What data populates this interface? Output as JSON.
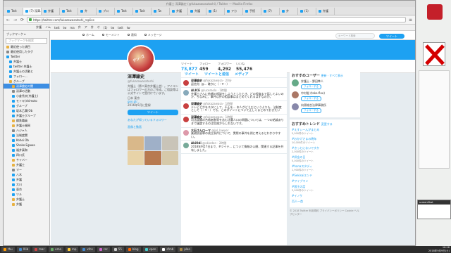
{
  "window": {
    "title": "弁護士 深澤論史 (@fukazawasatoshi) / Twitter — Mozilla Firefox"
  },
  "tabs": [
    "Twit",
    "(7) 深澤...",
    "弁護",
    "Twit",
    "弁",
    "プロ",
    "Twit",
    "Twit",
    "Tw",
    "弁護",
    "弁護",
    "(1)",
    "アカ",
    "手続",
    "(7)",
    "弁",
    "(1)",
    "弁護"
  ],
  "url": "https://twitter.com/fukazawasatoshi_replies",
  "bookmarks": [
    "弁護",
    "ノム",
    "twit",
    "tw",
    "ma",
    "弁",
    "ア",
    "弁",
    "オ",
    "(1)",
    "tw",
    "twit",
    "tw"
  ],
  "sidebar": {
    "header": "ブックマーク ▾",
    "search_placeholder": "ブックマークを検索",
    "items": [
      "最近使った項目",
      "最近使用したタグ",
      "Twitter",
      "弁護士",
      "twitter 弁護士",
      "弁護士の活動と",
      "フォロー...",
      "グループ",
      "深澤論史の関",
      "深澤の活動",
      "小倉秀夫(弁護士)",
      "モトキ(shimoto",
      "グループ",
      "坂本乙葉(Ob",
      "弁護士グループ",
      "鋼鉄職員",
      "弁護士福岡",
      "ハジャ人",
      "法制度関",
      "Kohei Ob",
      "Shoko Egawa",
      "福井真和",
      "四川氏",
      "サイバー",
      "弁護士",
      "マー",
      "八木",
      "弁護",
      "大川",
      "東京",
      "ツル",
      "弁護士",
      "弁護"
    ]
  },
  "twitter_nav": {
    "home": "ホーム",
    "moments": "モーメント",
    "notifications": "通知",
    "messages": "メッセージ",
    "search_placeholder": "キーワード検索",
    "tweet_button": "ツイート"
  },
  "stats": [
    {
      "label": "ツイート",
      "value": "73,877"
    },
    {
      "label": "フォロー",
      "value": "459"
    },
    {
      "label": "フォロワー",
      "value": "4,292"
    },
    {
      "label": "いいね",
      "value": "55,476"
    }
  ],
  "follow_button": "フォローする",
  "profile": {
    "name": "深澤諭史",
    "handle": "@fukazawasatoshi",
    "bio": "弁護士（第二東京弁護士会）。アイコンはフォロワーの方のご作成。ご相談等は公式サイトで受付けています。",
    "location": "日本 東京",
    "url": "goo.gl/...",
    "joined": "2016年5月に登録",
    "tweet_label": "ツイート",
    "followers_label": "あなたが知っているフォロワー",
    "photos_label": "画像と動画"
  },
  "feed": {
    "tabs": [
      "ツイート",
      "ツイートと返信",
      "メディア"
    ],
    "tweets": [
      {
        "name": "深澤諭史",
        "handle": "@fukazawasa · 20分",
        "text": "返信先: @... 確かに（・∀・）"
      },
      {
        "name": "ALICE",
        "handle": "@lucemelo · 1時間",
        "text": "弁護士さんに依頼の相談をしようとしたとき、どの程度まで話してよいのか、ちなみに、事件以外の相談事はまとめてくれるはずなのか。"
      },
      {
        "name": "深澤諭史",
        "handle": "@fukazawasa · 1時間",
        "text": "テレビとかをネタにして、不正を... 本人がどうだというよりも、法制度として（・∀・）でも、このポイントについて正しくまとめておきたい"
      },
      {
        "name": "深澤諭史",
        "handle": "@fukazawasa · 1時間",
        "text": "司法試験の合格者数等を含む法曹人口の問題については、一つの結論ありきで議論するのは危険かもしれないです。"
      },
      {
        "name": "大石さんローマ",
        "handle": "@lol_lawyer",
        "text": "業務妨害罪の成立条件について、実際の事件を例に考えるとわかりやすい。"
      },
      {
        "name": "AkiOdi",
        "handle": "@akiodan · 2時間",
        "text": "2018年9月7日まで、#ツイテ... について情報の公開、関連する記事を共有しました。"
      }
    ]
  },
  "who_to_follow": {
    "title": "おすすめユーザー",
    "refresh": "更新 · すべて表示",
    "users": [
      {
        "name": "弁護士・野田隼人",
        "button": "フォローする"
      },
      {
        "name": "中村聡 (take-flee)",
        "button": "フォローする"
      },
      {
        "name": "向原総合法律事務所",
        "button": "フォローする"
      }
    ]
  },
  "trends": {
    "title": "おすすめトレンド",
    "change": "変更する",
    "items": [
      {
        "tag": "#えすぃーんがまとめ",
        "count": "5,000件のツイート"
      },
      {
        "tag": "#おかげさまの晩年",
        "count": "10,000件のツイート"
      },
      {
        "tag": "#きっとにないですか",
        "count": "2,000件のツイート"
      },
      {
        "tag": "#拝金の日",
        "count": "5,000件のツイート"
      },
      {
        "tag": "#hanaスタディ",
        "count": "1,900件のツイート"
      },
      {
        "tag": "#Sekisaiエンド",
        "count": ""
      },
      {
        "tag": "#ワイプマン",
        "count": ""
      },
      {
        "tag": "#国王の話",
        "count": "3,000件のツイート"
      },
      {
        "tag": "#イノケ",
        "count": ""
      },
      {
        "tag": "百人一首",
        "count": ""
      }
    ]
  },
  "footer": "© 2018 Twitter 利用規約 プライバシーポリシー Cookie ヘルプセンター",
  "taskbar": {
    "items": [
      "thu",
      "Xlib",
      "mar",
      "ema",
      "mp",
      "xfce",
      "rsc",
      "55",
      "blog",
      "vpen",
      "sfmb",
      "plan"
    ],
    "clock": "16:28",
    "date": "2018年9月9日(土)"
  },
  "popup": {
    "title": "screenShot"
  },
  "colors": {
    "twitter_blue": "#1da1f2",
    "background": "#e6ecf0"
  }
}
